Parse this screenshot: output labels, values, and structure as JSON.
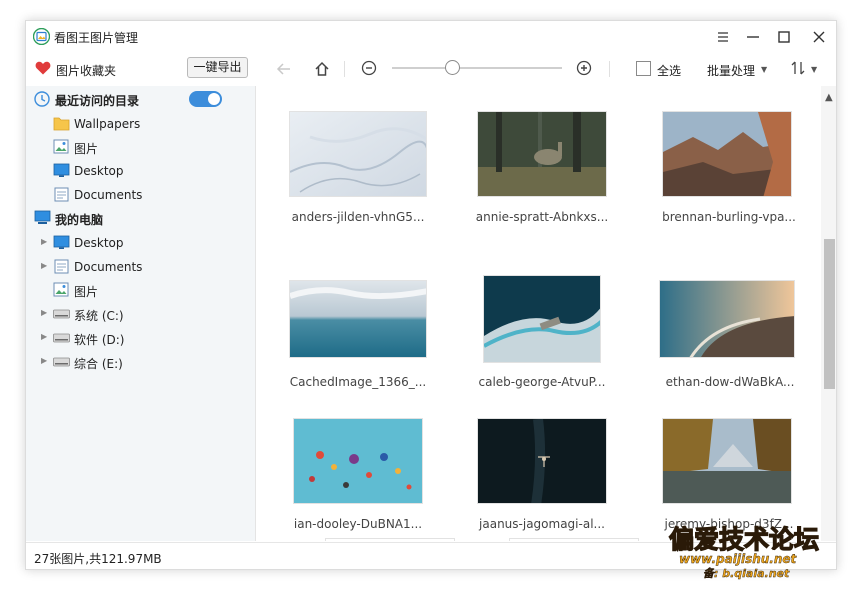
{
  "window": {
    "title": "看图王图片管理"
  },
  "toolbar": {
    "favorites_label": "图片收藏夹",
    "export_label": "一键导出",
    "select_all_label": "全选",
    "batch_label": "批量处理"
  },
  "sidebar": {
    "recent_label": "最近访问的目录",
    "recent_toggle_on": true,
    "recent_items": [
      {
        "label": "Wallpapers",
        "icon": "folder-icon"
      },
      {
        "label": "图片",
        "icon": "pictures-icon"
      },
      {
        "label": "Desktop",
        "icon": "desktop-icon"
      },
      {
        "label": "Documents",
        "icon": "documents-icon"
      }
    ],
    "computer_label": "我的电脑",
    "computer_items": [
      {
        "label": "Desktop",
        "icon": "desktop-icon",
        "expandable": true
      },
      {
        "label": "Documents",
        "icon": "documents-icon",
        "expandable": true
      },
      {
        "label": "图片",
        "icon": "pictures-icon",
        "expandable": false
      },
      {
        "label": "系统 (C:)",
        "icon": "drive-icon",
        "expandable": true
      },
      {
        "label": "软件 (D:)",
        "icon": "drive-icon",
        "expandable": true
      },
      {
        "label": "综合 (E:)",
        "icon": "drive-icon",
        "expandable": true
      }
    ]
  },
  "thumbnails": [
    {
      "caption": "anders-jilden-vhnG5...",
      "icon": "snow-landscape-image"
    },
    {
      "caption": "annie-spratt-Abnkxs...",
      "icon": "forest-deer-image"
    },
    {
      "caption": "brennan-burling-vpa...",
      "icon": "canyon-image"
    },
    {
      "caption": "CachedImage_1366_...",
      "icon": "ocean-horizon-image"
    },
    {
      "caption": "caleb-george-AtvuP...",
      "icon": "aerial-beach-image"
    },
    {
      "caption": "ethan-dow-dWaBkA...",
      "icon": "coastline-sunset-image"
    },
    {
      "caption": "ian-dooley-DuBNA1...",
      "icon": "hot-air-balloons-image"
    },
    {
      "caption": "jaanus-jagomagi-al...",
      "icon": "dark-water-swimmer-image"
    },
    {
      "caption": "jeremy-bishop-d3fZ...",
      "icon": "autumn-lake-image"
    }
  ],
  "status": {
    "text": "27张图片,共121.97MB"
  },
  "watermark": {
    "title": "偏爱技术论坛",
    "url": "www.paijishu.net",
    "sub": "备: b.qiaia.net"
  },
  "colors": {
    "accent": "#3c8ddb",
    "heart": "#e03b3b",
    "sidebar_bg": "#f3f6f8"
  }
}
